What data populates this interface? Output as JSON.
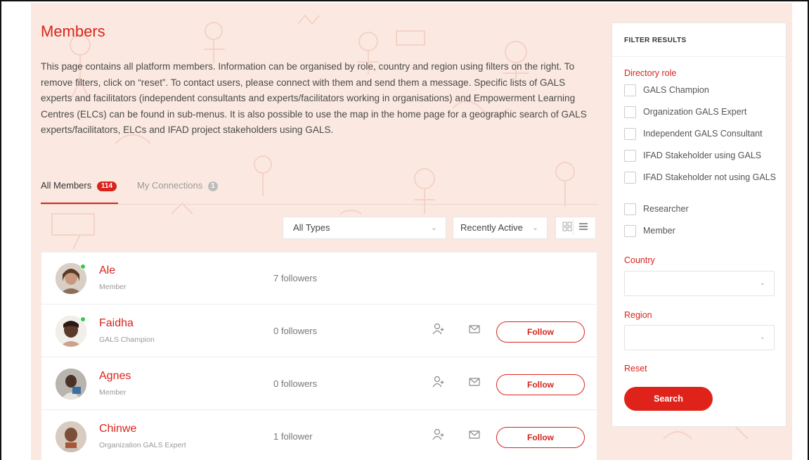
{
  "page": {
    "title": "Members",
    "intro": "This page contains all platform members. Information can be organised by role, country and region using filters on the right. To remove filters, click on “reset”. To contact users, please connect with them and send them a message. Specific lists of GALS experts and facilitators (independent consultants and experts/facilitators working in organisations) and Empowerment Learning Centres (ELCs) can be found in sub-menus. It is also possible to use the map in the home page for a geographic search of GALS experts/facilitators, ELCs and IFAD project stakeholders using GALS."
  },
  "tabs": [
    {
      "label": "All Members",
      "count": "114"
    },
    {
      "label": "My Connections",
      "count": "1"
    }
  ],
  "filters": {
    "type_selected": "All Types",
    "order_selected": "Recently Active",
    "grid_icon": "grid-view-icon",
    "list_icon": "list-view-icon"
  },
  "members": [
    {
      "name": "Ale",
      "role": "Member",
      "followers": "7 followers",
      "online": true,
      "show_actions": false
    },
    {
      "name": "Faidha",
      "role": "GALS Champion",
      "followers": "0 followers",
      "online": true,
      "show_actions": true,
      "follow_label": "Follow"
    },
    {
      "name": "Agnes",
      "role": "Member",
      "followers": "0 followers",
      "online": false,
      "show_actions": true,
      "follow_label": "Follow"
    },
    {
      "name": "Chinwe",
      "role": "Organization GALS Expert",
      "followers": "1 follower",
      "online": false,
      "show_actions": true,
      "follow_label": "Follow"
    }
  ],
  "sidebar": {
    "title": "FILTER RESULTS",
    "directory_role_label": "Directory role",
    "roles": [
      "GALS Champion",
      "Organization GALS Expert",
      "Independent GALS Consultant",
      "IFAD Stakeholder using GALS",
      "IFAD Stakeholder not using GALS",
      "Researcher",
      "Member"
    ],
    "country_label": "Country",
    "region_label": "Region",
    "reset_label": "Reset",
    "search_label": "Search"
  },
  "colors": {
    "accent": "#d8241c",
    "background": "#fbe9e1",
    "online": "#2ecc40"
  }
}
